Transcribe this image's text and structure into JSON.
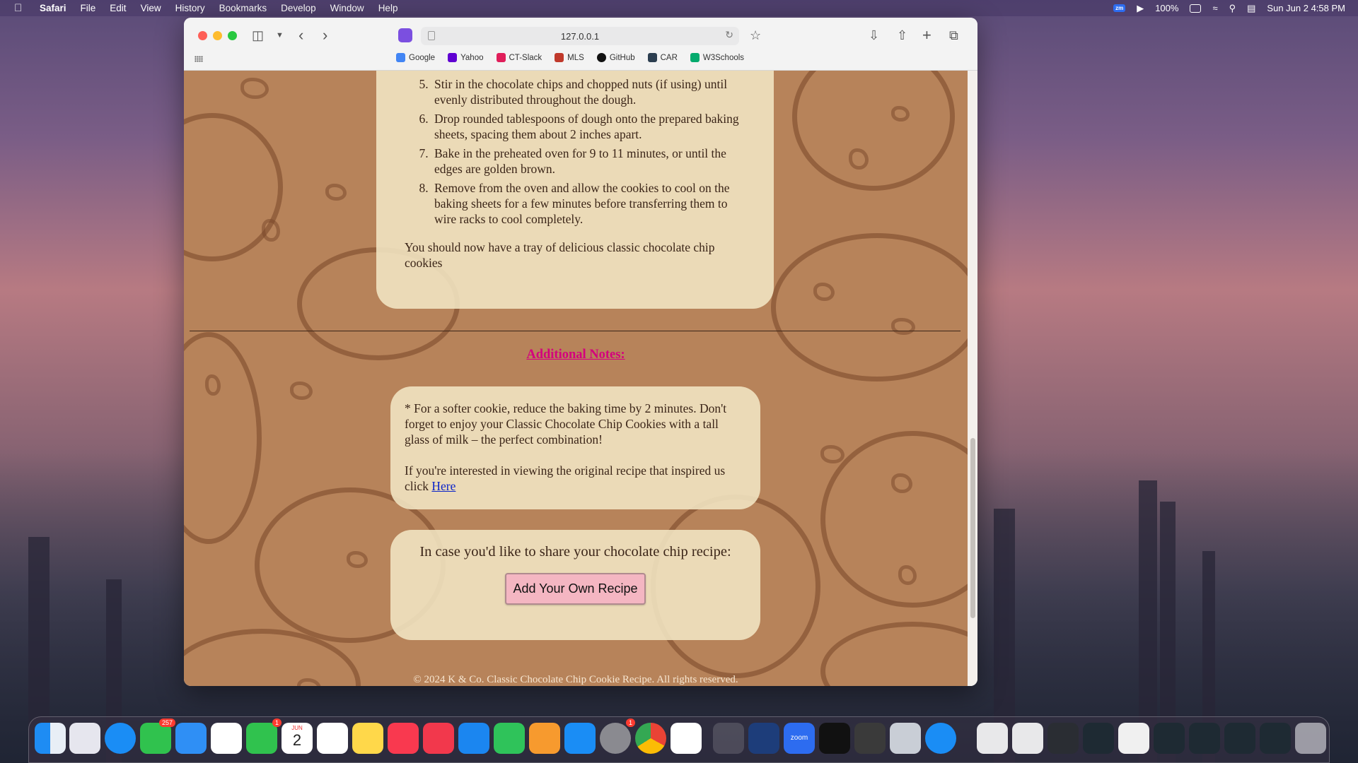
{
  "menubar": {
    "app": "Safari",
    "items": [
      "File",
      "Edit",
      "View",
      "History",
      "Bookmarks",
      "Develop",
      "Window",
      "Help"
    ],
    "battery": "100%",
    "datetime": "Sun Jun 2  4:58 PM",
    "zoom_label": "zm"
  },
  "browser": {
    "url": "127.0.0.1",
    "bookmarks": [
      {
        "label": "Google",
        "color": "#4285f4"
      },
      {
        "label": "Yahoo",
        "color": "#6001d2"
      },
      {
        "label": "CT-Slack",
        "color": "#e01e5a"
      },
      {
        "label": "MLS",
        "color": "#c0392b"
      },
      {
        "label": "GitHub",
        "color": "#111111"
      },
      {
        "label": "CAR",
        "color": "#2c3e50"
      },
      {
        "label": "W3Schools",
        "color": "#04aa6d"
      }
    ]
  },
  "page": {
    "steps_start": 5,
    "steps": [
      "Stir in the chocolate chips and chopped nuts (if using) until evenly distributed throughout the dough.",
      "Drop rounded tablespoons of dough onto the prepared baking sheets, spacing them about 2 inches apart.",
      "Bake in the preheated oven for 9 to 11 minutes, or until the edges are golden brown.",
      "Remove from the oven and allow the cookies to cool on the baking sheets for a few minutes before transferring them to wire racks to cool completely."
    ],
    "conclusion": "You should now have a tray of delicious classic chocolate chip cookies",
    "notes_title": "Additional Notes:",
    "note_1": "* For a softer cookie, reduce the baking time by 2 minutes. Don't forget to enjoy your Classic Chocolate Chip Cookies with a tall glass of milk – the perfect combination!",
    "note_2_prefix": "If you're interested in viewing the original recipe that inspired us click ",
    "note_2_link": "Here",
    "share_text": "In case you'd like to share your chocolate chip recipe:",
    "share_button": "Add Your Own Recipe",
    "footer": "© 2024 K & Co. Classic Chocolate Chip Cookie Recipe. All rights reserved."
  },
  "dock": {
    "badges": {
      "messages": "257",
      "facetime": "1",
      "settings": "1"
    },
    "calendar_month": "JUN",
    "calendar_day": "2",
    "zoom_label": "zoom"
  }
}
